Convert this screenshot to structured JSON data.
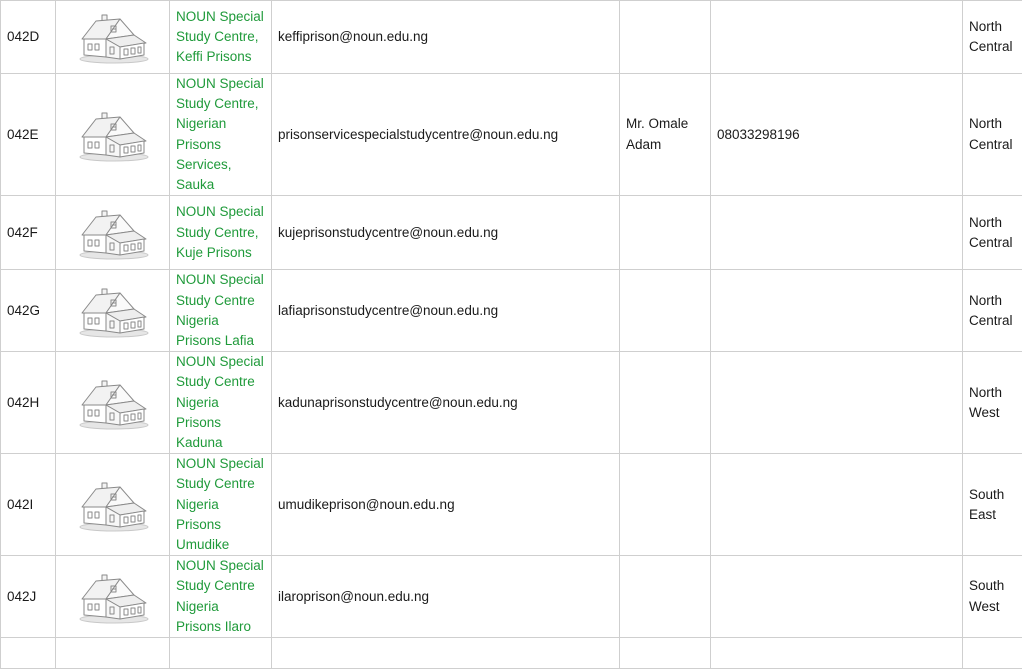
{
  "rows": [
    {
      "code": "042D",
      "name": "NOUN Special Study Centre, Keffi Prisons",
      "email": "keffiprison@noun.edu.ng",
      "director": "",
      "phone": "",
      "zone": "North Central"
    },
    {
      "code": "042E",
      "name": "NOUN Special Study Centre, Nigerian Prisons Services, Sauka",
      "email": "prisonservicespecialstudycentre@noun.edu.ng",
      "director": "Mr. Omale Adam",
      "phone": "08033298196",
      "zone": "North Central"
    },
    {
      "code": "042F",
      "name": "NOUN Special Study Centre, Kuje Prisons",
      "email": "kujeprisonstudycentre@noun.edu.ng",
      "director": "",
      "phone": "",
      "zone": "North Central"
    },
    {
      "code": "042G",
      "name": "NOUN Special Study Centre Nigeria Prisons Lafia",
      "email": "lafiaprisonstudycentre@noun.edu.ng",
      "director": "",
      "phone": "",
      "zone": "North Central"
    },
    {
      "code": "042H",
      "name": "NOUN Special Study Centre Nigeria Prisons Kaduna",
      "email": "kadunaprisonstudycentre@noun.edu.ng",
      "director": "",
      "phone": "",
      "zone": "North West"
    },
    {
      "code": "042I",
      "name": "NOUN Special Study Centre Nigeria Prisons Umudike",
      "email": "umudikeprison@noun.edu.ng",
      "director": "",
      "phone": "",
      "zone": "South East"
    },
    {
      "code": "042J",
      "name": "NOUN Special Study Centre Nigeria Prisons Ilaro",
      "email": "ilaroprison@noun.edu.ng",
      "director": "",
      "phone": "",
      "zone": "South West"
    }
  ],
  "colors": {
    "name_text": "#1f9a3a",
    "border": "#cfcfcf",
    "icon_stroke": "#8a8a8a"
  },
  "icons": {
    "centre_image": "house-icon"
  }
}
